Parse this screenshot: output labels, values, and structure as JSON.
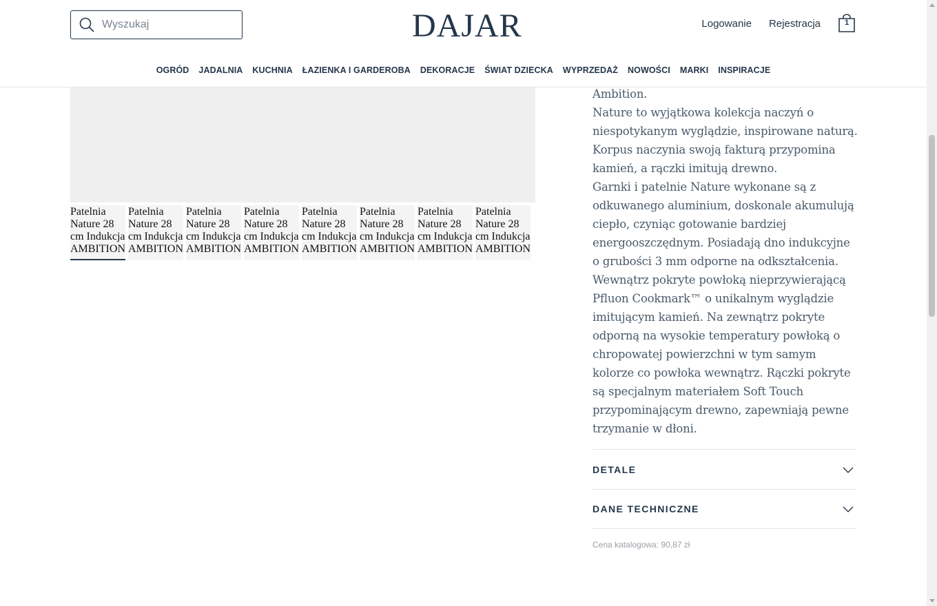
{
  "header": {
    "search_placeholder": "Wyszukaj",
    "logo": "DAJAR",
    "login": "Logowanie",
    "register": "Rejestracja",
    "cart_count": "1",
    "nav": [
      "OGRÓD",
      "JADALNIA",
      "KUCHNIA",
      "ŁAZIENKA I GARDEROBA",
      "DEKORACJE",
      "ŚWIAT DZIECKA",
      "WYPRZEDAŻ",
      "NOWOŚCI",
      "MARKI",
      "INSPIRACJE"
    ]
  },
  "gallery": {
    "thumb_alt": "Patelnia Nature 28 cm Indukcja AMBITION",
    "thumb_count": 8,
    "active_index": 0
  },
  "description": {
    "paragraphs": [
      "Ambition.",
      "Nature to wyjątkowa kolekcja naczyń o niespotykanym wyglądzie, inspirowane naturą. Korpus naczynia swoją fakturą przypomina kamień, a rączki imitują drewno.",
      "Garnki i patelnie Nature wykonane są z odkuwanego aluminium, doskonale akumulują ciepło, czyniąc gotowanie bardziej energooszczędnym. Posiadają dno indukcyjne o grubości 3 mm odporne na odkształcenia. Wewnątrz pokryte powłoką nieprzywierającą Pfluon Cookmark™ o unikalnym wyglądzie imitującym kamień. Na zewnątrz pokryte odporną na wysokie temperatury powłoką o chropowatej powierzchni w tym samym kolorze co powłoka wewnątrz. Rączki pokryte są specjalnym materiałem Soft Touch przypominającym drewno, zapewniają pewne trzymanie w dłoni."
    ]
  },
  "accordions": {
    "details": "DETALE",
    "tech": "DANE TECHNICZNE"
  },
  "price_note": "Cena katalogowa: 90,87 zł",
  "colors": {
    "brand": "#24364a",
    "text": "#4a5a6a",
    "muted": "#9aa0a6"
  }
}
